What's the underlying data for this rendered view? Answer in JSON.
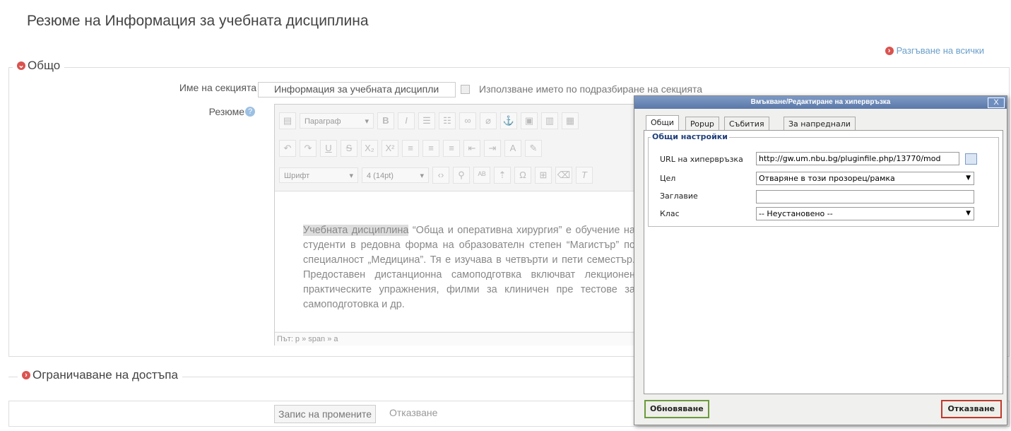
{
  "page": {
    "title": "Резюме на Информация за учебната дисциплина",
    "expand_all": "Разгъване на всички"
  },
  "general": {
    "legend": "Общо",
    "section_name_label": "Име на секцията",
    "section_name_value": "Информация за учебната дисципли",
    "use_default_label": "Използване името по подразбиране на секцията",
    "summary_label": "Резюме"
  },
  "editor": {
    "paragraph_select": "Параграф",
    "font_select": "Шрифт",
    "size_select": "4 (14pt)",
    "content_highlight": "Учебната дисциплина",
    "content_rest": " “Обща и оперативна хирургия” е обучение на студенти в редовна форма на образователн степен “Магистър” по специалност „Медицина”. Тя е изучава в четвърти и пети семестър. Предоставен дистанционна самоподготвка включват лекционен практическите упражнения, филми за клиничен пре тестове за самоподготовка и др.",
    "path": "Път: p » span » a"
  },
  "restrict": {
    "legend": "Ограничаване на достъпа"
  },
  "actions": {
    "save": "Запис на промените",
    "cancel": "Отказване"
  },
  "dialog": {
    "title": "Вмъкване/Редактиране на хипервръзка",
    "close": "X",
    "tabs": [
      "Общи",
      "Popup",
      "Събития",
      "За напреднали"
    ],
    "fieldset_legend": "Общи настройки",
    "url_label": "URL на хипервръзка",
    "url_value": "http://gw.um.nbu.bg/pluginfile.php/13770/mod",
    "target_label": "Цел",
    "target_value": "Отваряне в този прозорец/рамка",
    "title_label": "Заглавие",
    "title_value": "",
    "class_label": "Клас",
    "class_value": "-- Неустановено --",
    "update_button": "Обновяване",
    "cancel_button": "Отказване"
  }
}
